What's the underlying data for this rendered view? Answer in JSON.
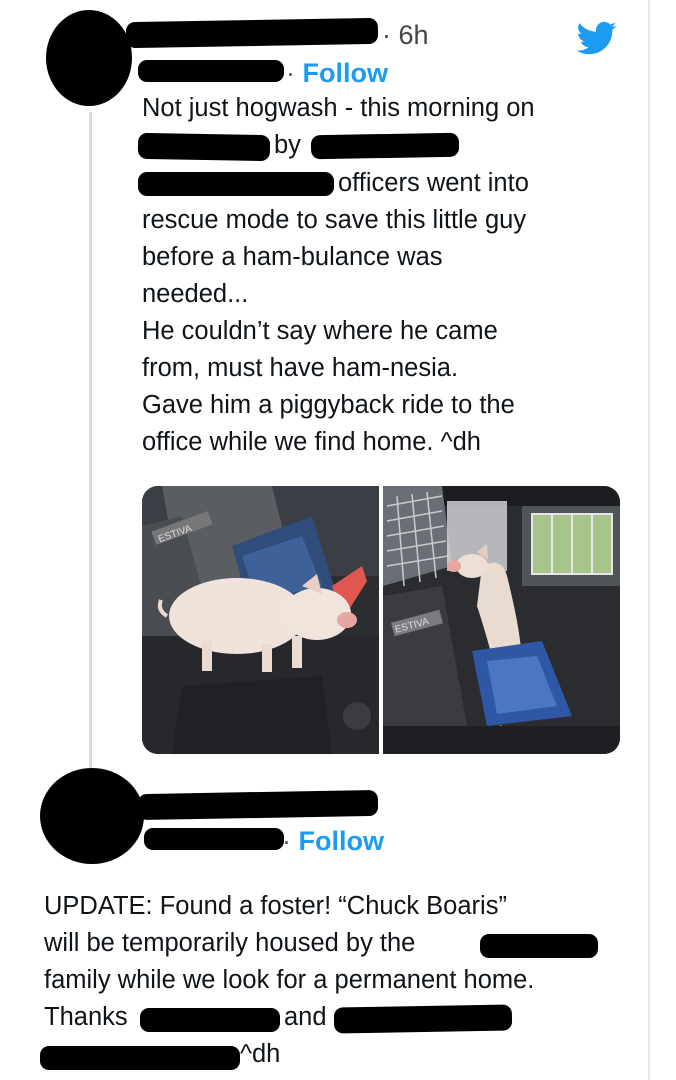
{
  "tweet1": {
    "time": "6h",
    "follow_label": "Follow",
    "line1": "Not just hogwash - this morning on",
    "line2_by": "by",
    "line3": "officers went into",
    "line4": "rescue mode to save this little guy",
    "line5": "before a ham-bulance was",
    "line6": "needed...",
    "line7": "He couldn’t say where he came",
    "line8": "from, must have ham-nesia.",
    "line9": "Gave him a piggyback ride to the",
    "line10": "office while we find home. ^dh",
    "media": {
      "left_badge": "ESTIVA",
      "right_badge": "ESTIVA"
    }
  },
  "tweet2": {
    "follow_label": "Follow",
    "line1": "UPDATE: Found a foster! “Chuck Boaris”",
    "line2": "will be temporarily housed by the",
    "line3": "family while we look for a permanent home.",
    "line4_a": "Thanks",
    "line4_b": "and",
    "line5": "^dh"
  },
  "colors": {
    "follow_blue": "#1d9bf0",
    "twitter_blue": "#1d9bf0",
    "thread_line": "#cfd9de"
  },
  "icons": [
    "twitter-bird-icon"
  ]
}
